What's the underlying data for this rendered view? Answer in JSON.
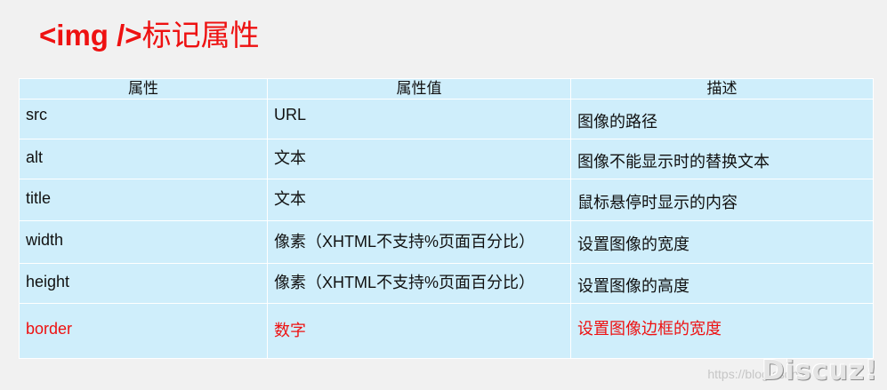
{
  "title": {
    "code": "<img />",
    "text": "标记属性"
  },
  "table": {
    "headers": [
      "属性",
      "属性值",
      "描述"
    ],
    "rows": [
      {
        "attr": "src",
        "value": "URL",
        "desc": "图像的路径"
      },
      {
        "attr": "alt",
        "value": "文本",
        "desc": "图像不能显示时的替换文本"
      },
      {
        "attr": "title",
        "value": "文本",
        "desc": "鼠标悬停时显示的内容"
      },
      {
        "attr": "width",
        "value": "像素（XHTML不支持%页面百分比）",
        "desc": "设置图像的宽度"
      },
      {
        "attr": "height",
        "value": "像素（XHTML不支持%页面百分比）",
        "desc": "设置图像的高度"
      },
      {
        "attr": "border",
        "value": "数字",
        "desc": "设置图像边框的宽度"
      }
    ]
  },
  "watermark": {
    "url": "https://blog.csdn.n",
    "logo": "Discuz!"
  },
  "colors": {
    "accent_red": "#ee1111",
    "table_bg": "#cfeefb",
    "page_bg": "#f1f1f1"
  }
}
